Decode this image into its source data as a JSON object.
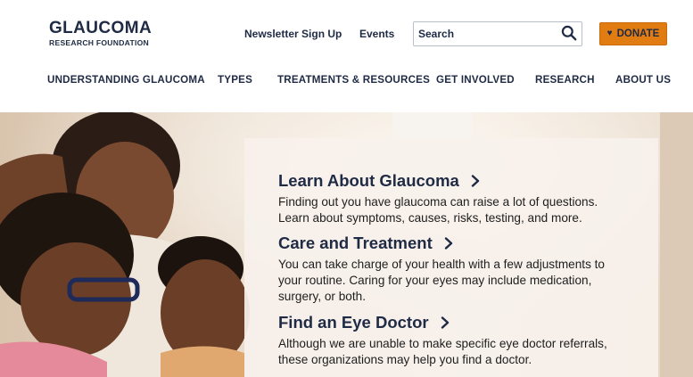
{
  "logo": {
    "main": "GLAUCOMA",
    "sub": "RESEARCH FOUNDATION"
  },
  "utility": {
    "newsletter": "Newsletter Sign Up",
    "events": "Events",
    "search_placeholder": "Search",
    "search_icon": "search-icon",
    "donate_label": "DONATE",
    "donate_icon": "heart-icon",
    "donate_color": "#e07c12"
  },
  "nav": {
    "items": [
      {
        "label": "UNDERSTANDING GLAUCOMA"
      },
      {
        "label": "TYPES"
      },
      {
        "label": "TREATMENTS & RESOURCES"
      },
      {
        "label": "GET INVOLVED"
      },
      {
        "label": "RESEARCH"
      },
      {
        "label": "ABOUT US"
      }
    ]
  },
  "hero": {
    "cards": [
      {
        "title": "Learn About Glaucoma",
        "text": "Finding out you have glaucoma can raise a lot of questions. Learn about symptoms, causes, risks, testing, and more."
      },
      {
        "title": "Care and Treatment",
        "text": "You can take charge of your health with a few adjustments to your routine. Caring for your eyes may include medication, surgery, or both."
      },
      {
        "title": "Find an Eye Doctor",
        "text": "Although we are unable to make specific eye doctor referrals, these organizations may help you find a doctor."
      }
    ]
  },
  "colors": {
    "navy": "#1f2a44",
    "panel": "#f7f1ec",
    "accent": "#e07c12"
  }
}
